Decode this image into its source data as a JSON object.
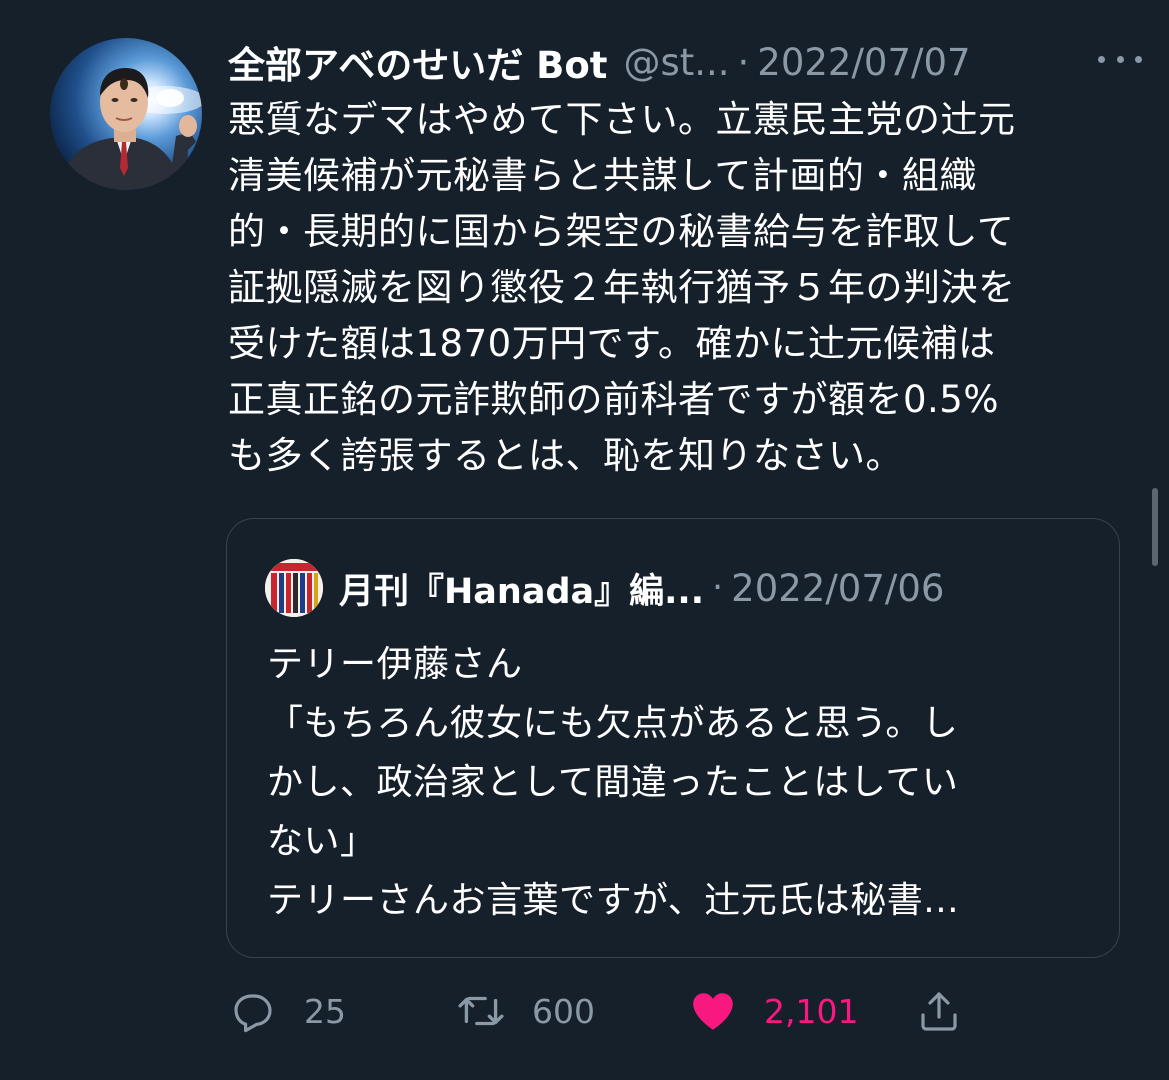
{
  "tweet": {
    "display_name": "全部アベのせいだ Bot",
    "handle": "@st...",
    "separator": "·",
    "date": "2022/07/07",
    "text": "悪質なデマはやめて下さい。立憲民主党の辻元\n清美候補が元秘書らと共謀して計画的・組織\n的・長期的に国から架空の秘書給与を詐取して\n証拠隠滅を図り懲役２年執行猶予５年の判決を\n受けた額は1870万円です。確かに辻元候補は\n正真正銘の元詐欺師の前科者ですが額を0.5%\nも多く誇張するとは、恥を知りなさい。"
  },
  "quoted_tweet": {
    "display_name": "月刊『Hanada』編...",
    "separator": "·",
    "date": "2022/07/06",
    "text": "テリー伊藤さん\n「もちろん彼女にも欠点があると思う。し\nかし、政治家として間違ったことはしてい\nない」\nテリーさんお言葉ですが、辻元氏は秘書..."
  },
  "actions": {
    "reply": {
      "icon": "reply-icon",
      "count": "25"
    },
    "retweet": {
      "icon": "retweet-icon",
      "count": "600"
    },
    "like": {
      "icon": "heart-icon",
      "count": "2,101",
      "color": "#f91880"
    },
    "share": {
      "icon": "share-icon"
    }
  },
  "colors": {
    "background": "#15202b",
    "text": "#ffffff",
    "secondary_text": "#8b98a5",
    "border": "#38444d",
    "like": "#f91880"
  }
}
